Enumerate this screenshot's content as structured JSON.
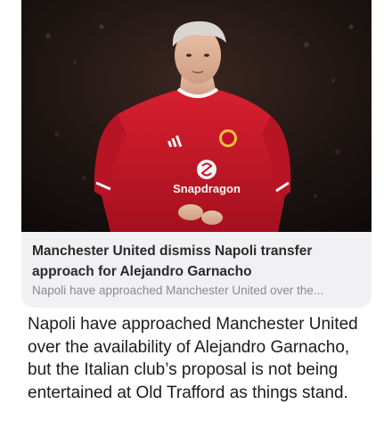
{
  "link_card": {
    "image_icon": "player-photo",
    "sponsor_text": "Snapdragon",
    "title": "Manchester United dismiss Napoli transfer approach for Alejandro Garnacho",
    "description": "Napoli have approached Manchester United over the..."
  },
  "post": {
    "body": "Napoli have approached Manchester United over the availability of Alejandro Garnacho, but the Italian club’s proposal is not being entertained at Old Trafford as things stand."
  },
  "colors": {
    "card_background": "#f1f1f3",
    "kit_red": "#c8102e",
    "title_text": "#2a2a2a",
    "description_text": "#8a8a8e"
  }
}
